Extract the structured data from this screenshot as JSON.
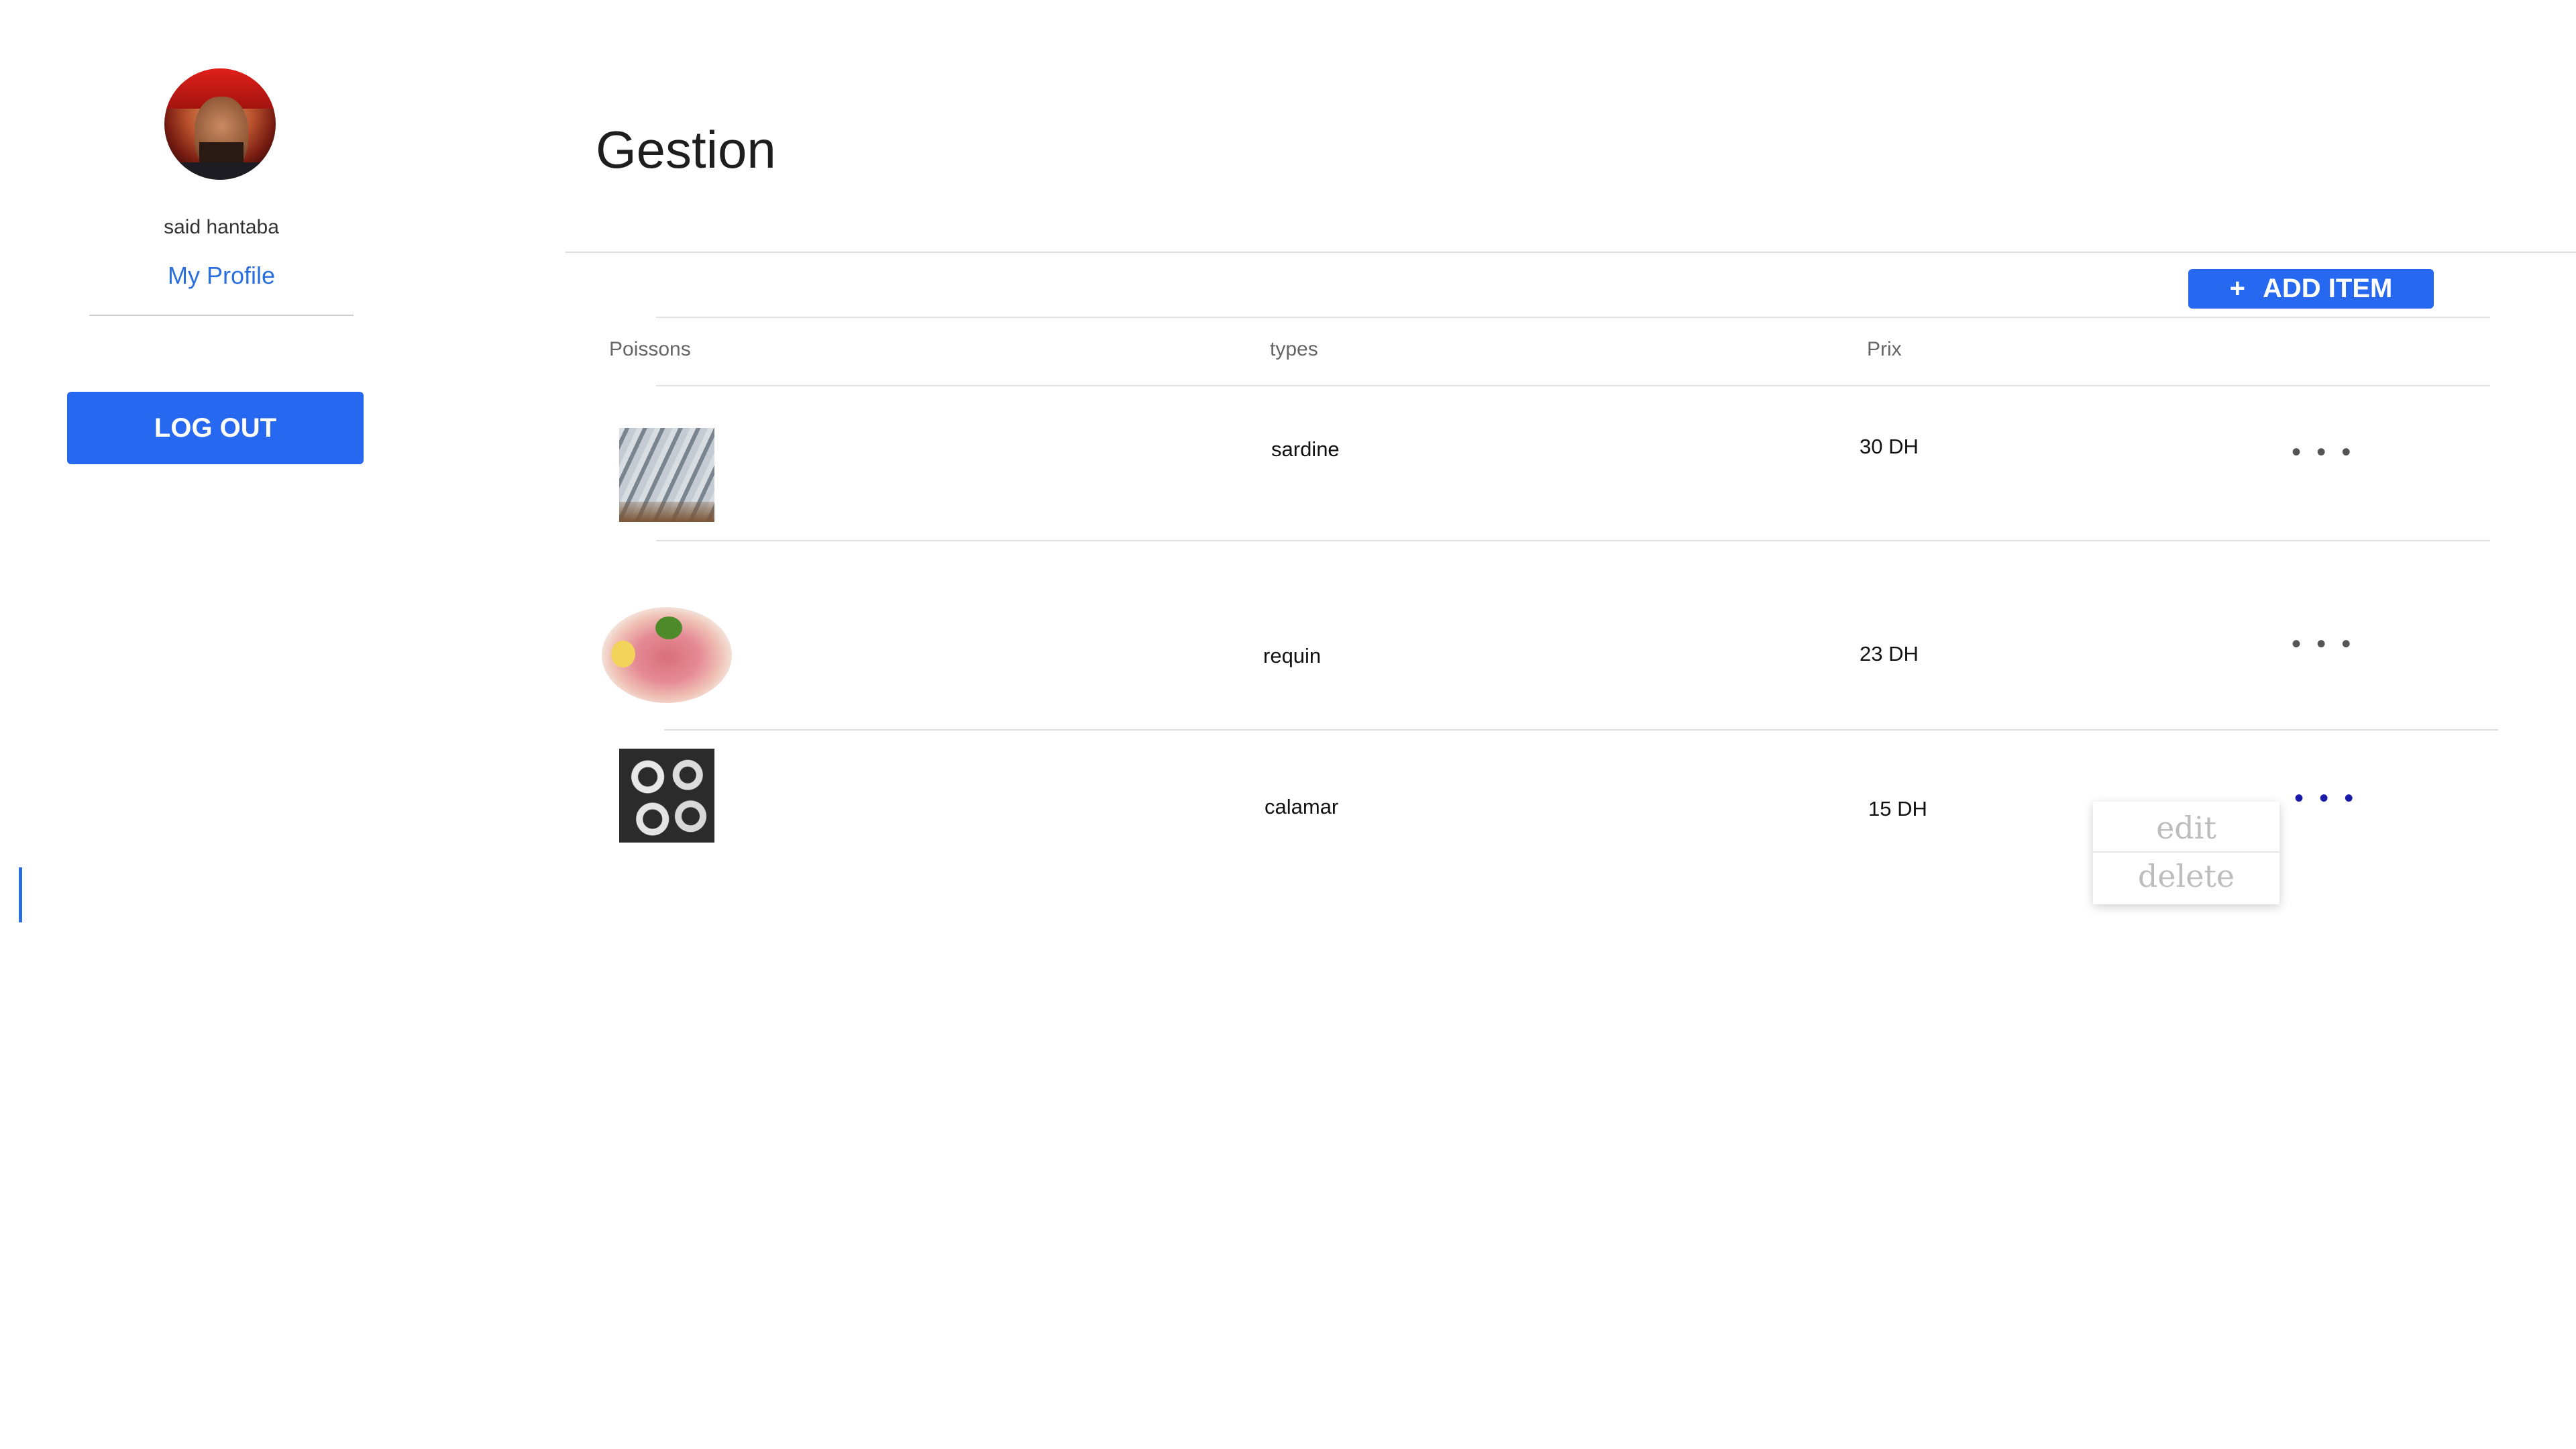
{
  "sidebar": {
    "username": "said hantaba",
    "profile_link": "My Profile",
    "logout_label": "LOG OUT"
  },
  "main": {
    "title": "Gestion",
    "add_button": {
      "icon": "+",
      "label": "ADD ITEM"
    },
    "table": {
      "columns": [
        "Poissons",
        "types",
        "Prix"
      ],
      "rows": [
        {
          "image": "sardine-photo",
          "type": "sardine",
          "price": "30 DH",
          "menu": "• • •"
        },
        {
          "image": "requin-photo",
          "type": "requin",
          "price": "23 DH",
          "menu": "• • •"
        },
        {
          "image": "calamar-photo",
          "type": "calamar",
          "price": "15 DH",
          "menu": "• • •"
        }
      ]
    },
    "row_menu": {
      "edit": "edit",
      "delete": "delete"
    }
  },
  "colors": {
    "accent": "#2768f0",
    "link": "#2a6fe0",
    "active_menu_dots": "#1a1aa8"
  }
}
